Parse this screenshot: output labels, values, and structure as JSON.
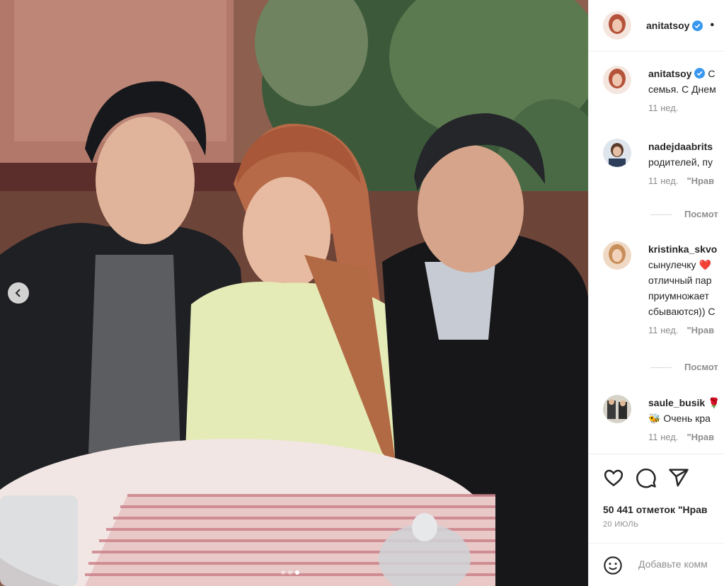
{
  "post": {
    "author": "anitatsoy",
    "author_more": "•",
    "image_alt": "Family photo at a restaurant table",
    "carousel": {
      "current": 3,
      "total": 3
    }
  },
  "caption": {
    "username": "anitatsoy",
    "text_line1": "С",
    "text_line2": "семья. С Днем",
    "time": "11 нед."
  },
  "comments": [
    {
      "username": "nadejdaabrits",
      "text_lines": [
        "родителей, пу"
      ],
      "time": "11 нед.",
      "like_label": "\"Нрав",
      "view_replies": "Посмот"
    },
    {
      "username": "kristinka_skvo",
      "text_lines": [
        "сынулечку ❤️",
        "отличный пар",
        "приумножает",
        "сбываются)) С"
      ],
      "time": "11 нед.",
      "like_label": "\"Нрав",
      "view_replies": "Посмот"
    },
    {
      "username": "saule_busik",
      "text_lines": [
        "🐝 Очень кра"
      ],
      "time": "11 нед.",
      "like_label": "\"Нрав"
    }
  ],
  "likes_text": "50 441 отметок \"Нрав",
  "date_text": "20 ИЮЛЬ",
  "add_comment_placeholder": "Добавьте комм",
  "colors": {
    "verified": "#3897f0",
    "heart": "#ed4956",
    "muted": "#8e8e8e"
  }
}
